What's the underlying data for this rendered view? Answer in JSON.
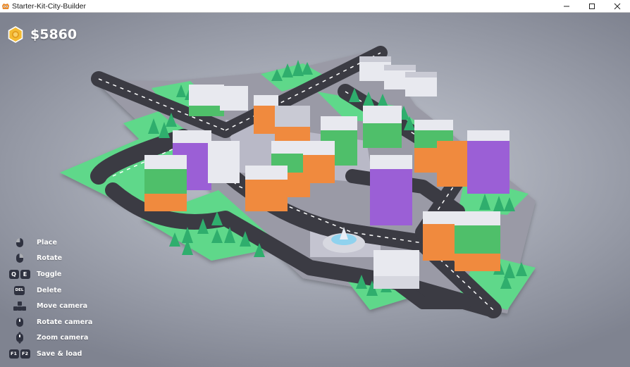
{
  "window": {
    "title": "Starter-Kit-City-Builder",
    "app_icon": "godot-icon",
    "buttons": [
      "minimize-icon",
      "maximize-icon",
      "close-icon"
    ]
  },
  "hud": {
    "money": "$5860",
    "money_icon": "coin-icon"
  },
  "controls": [
    {
      "label": "Place",
      "icon": "mouse-left-click-icon"
    },
    {
      "label": "Rotate",
      "icon": "mouse-right-click-icon"
    },
    {
      "label": "Toggle",
      "keys": [
        "Q",
        "E"
      ]
    },
    {
      "label": "Delete",
      "icon": "delete-key-icon",
      "key": "DEL"
    },
    {
      "label": "Move camera",
      "icon": "wasd-keys-icon"
    },
    {
      "label": "Rotate camera",
      "icon": "mouse-middle-icon"
    },
    {
      "label": "Zoom camera",
      "icon": "mouse-scroll-icon"
    },
    {
      "label": "Save & load",
      "keys": [
        "F1",
        "F2"
      ]
    }
  ],
  "colors": {
    "money_text": "#ffffff",
    "coin": "#f0b429",
    "grass": "#5fd88a",
    "road": "#3b3b43",
    "building_green": "#4fbf6a",
    "building_orange": "#f08a3e",
    "building_purple": "#9b5fd6",
    "building_white": "#e8e9ef"
  }
}
